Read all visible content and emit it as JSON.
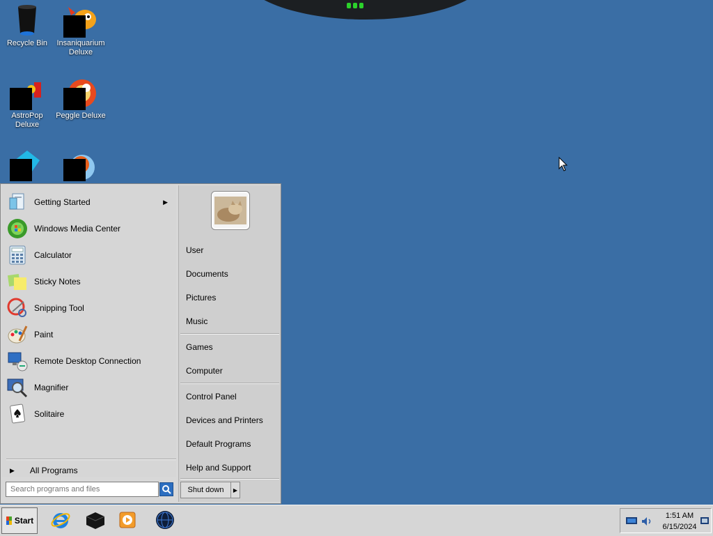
{
  "desktop": {
    "icons": [
      {
        "label": "Recycle Bin",
        "icon": "recycle-bin-icon"
      },
      {
        "label": "Insaniquarium Deluxe",
        "icon": "insaniquarium-icon"
      },
      {
        "label": "AstroPop Deluxe",
        "icon": "astropop-icon"
      },
      {
        "label": "Peggle Deluxe",
        "icon": "peggle-icon"
      },
      {
        "label": "",
        "icon": "diamond-game-icon"
      },
      {
        "label": "",
        "icon": "fruit-game-icon"
      }
    ]
  },
  "start_menu": {
    "programs": [
      {
        "label": "Getting Started",
        "icon": "getting-started-icon",
        "has_submenu": true
      },
      {
        "label": "Windows Media Center",
        "icon": "media-center-icon"
      },
      {
        "label": "Calculator",
        "icon": "calculator-icon"
      },
      {
        "label": "Sticky Notes",
        "icon": "sticky-notes-icon"
      },
      {
        "label": "Snipping Tool",
        "icon": "snipping-tool-icon"
      },
      {
        "label": "Paint",
        "icon": "paint-icon"
      },
      {
        "label": "Remote Desktop Connection",
        "icon": "remote-desktop-icon"
      },
      {
        "label": "Magnifier",
        "icon": "magnifier-icon"
      },
      {
        "label": "Solitaire",
        "icon": "solitaire-icon"
      }
    ],
    "all_programs_label": "All Programs",
    "search_placeholder": "Search programs and files",
    "right_items": [
      {
        "label": "User"
      },
      {
        "label": "Documents"
      },
      {
        "label": "Pictures"
      },
      {
        "label": "Music"
      },
      {
        "label": "Games"
      },
      {
        "label": "Computer"
      },
      {
        "label": "Control Panel"
      },
      {
        "label": "Devices and Printers"
      },
      {
        "label": "Default Programs"
      },
      {
        "label": "Help and Support"
      }
    ],
    "shutdown_label": "Shut down"
  },
  "taskbar": {
    "start_label": "Start",
    "pinned": [
      "internet-explorer-icon",
      "game-box-icon",
      "media-player-icon",
      "globe-icon"
    ],
    "clock_time": "1:51 AM",
    "clock_date": "6/15/2024"
  },
  "colors": {
    "desktop_bg": "#3a6ea5",
    "menu_bg": "#d6d6d6",
    "taskbar_bg": "#d6d6d6"
  }
}
